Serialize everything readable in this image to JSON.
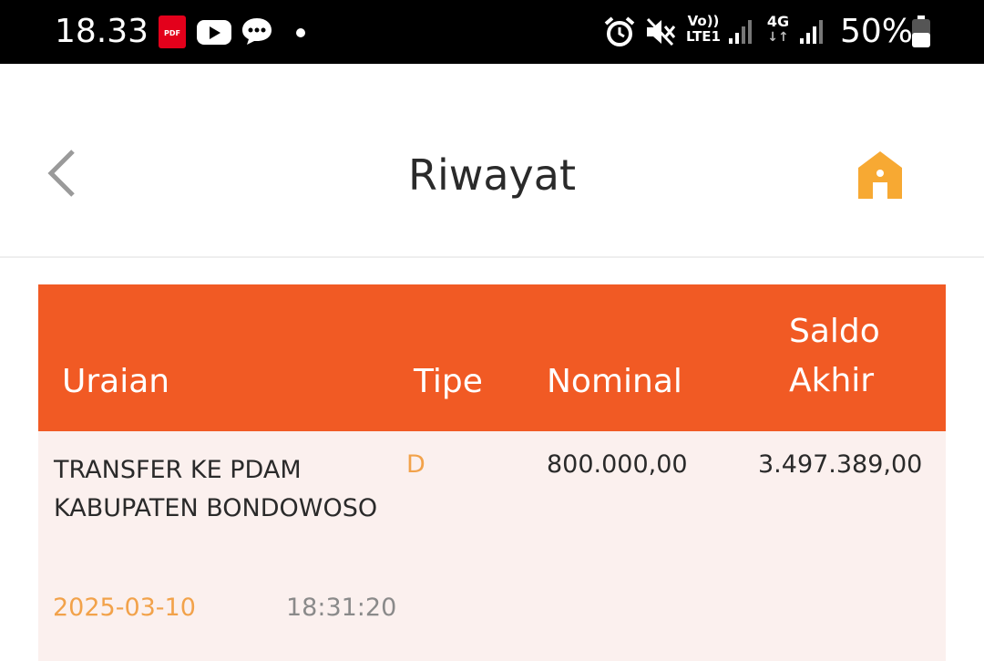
{
  "status_bar": {
    "time": "18.33",
    "battery": "50%",
    "network_label": "4G",
    "volte_label": "Vo))\nLTE1",
    "pdf_label": "PDF",
    "icons": [
      "pdf-icon",
      "youtube-icon",
      "chat-icon",
      "dot-icon",
      "alarm-icon",
      "mute-icon",
      "volte-icon",
      "signal-icon",
      "4g-icon",
      "signal-icon",
      "battery-icon"
    ]
  },
  "header": {
    "title": "Riwayat",
    "back_icon": "chevron-left-icon",
    "home_icon": "home-icon",
    "accent_color": "#f7a933"
  },
  "table": {
    "header_color": "#f15a24",
    "columns": {
      "uraian": "Uraian",
      "tipe": "Tipe",
      "nominal": "Nominal",
      "saldo_akhir": "Saldo\nAkhir"
    },
    "rows": [
      {
        "description": "TRANSFER KE PDAM KABUPATEN BONDOWOSO",
        "type": "D",
        "nominal": "800.000,00",
        "saldo_akhir": "3.497.389,00",
        "date": "2025-03-10",
        "time": "18:31:20"
      }
    ]
  }
}
